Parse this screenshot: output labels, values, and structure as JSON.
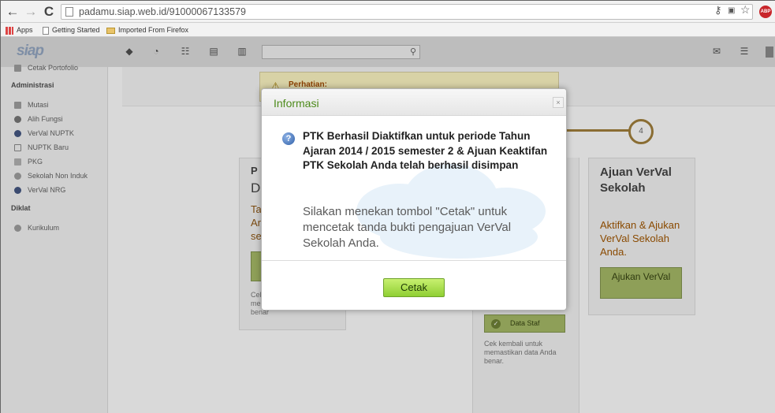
{
  "browser": {
    "url": "padamu.siap.web.id/91000067133579",
    "bookmarks": [
      "Apps",
      "Getting Started",
      "Imported From Firefox"
    ],
    "abp_label": "ABP"
  },
  "app": {
    "logo": "siap"
  },
  "sidebar": {
    "top_cut_item": "Cetak Portofolio",
    "sections": [
      {
        "title": "Administrasi",
        "items": [
          "Mutasi",
          "Alih Fungsi",
          "VerVal NUPTK",
          "NUPTK Baru",
          "PKG",
          "Sekolah Non Induk",
          "VerVal NRG"
        ]
      },
      {
        "title": "Diklat",
        "items": []
      },
      {
        "title": "",
        "items": [
          "Kurikulum"
        ]
      }
    ]
  },
  "background": {
    "warning_title": "Perhatian:",
    "step_number": "4",
    "card_left": {
      "title_lines": [
        "P",
        "D"
      ],
      "sub_lines": [
        "Ta",
        "Ar",
        "se"
      ],
      "note": [
        "Cek",
        "me",
        "benar"
      ]
    },
    "card_mid": {
      "button": "Data Staf",
      "note": "Cek kembali untuk memastikan data Anda benar."
    },
    "card_right": {
      "title": "Ajuan VerVal Sekolah",
      "subtitle": "Aktifkan & Ajukan VerVal Sekolah Anda.",
      "button": "Ajukan VerVal"
    }
  },
  "modal": {
    "title": "Informasi",
    "close_label": "×",
    "message_bold": "PTK Berhasil Diaktifkan untuk periode Tahun Ajaran 2014 / 2015 semester 2 & Ajuan Keaktifan PTK Sekolah Anda telah berhasil disimpan",
    "message_normal": "Silakan menekan tombol \"Cetak\" untuk mencetak tanda bukti pengajuan VerVal Sekolah Anda.",
    "button_label": "Cetak"
  }
}
